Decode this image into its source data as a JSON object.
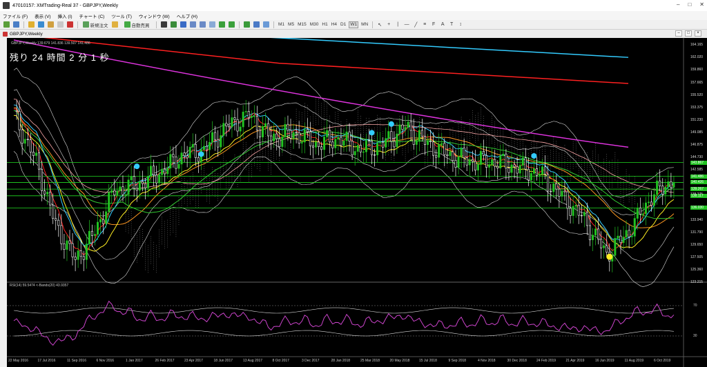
{
  "window": {
    "title": "47010157: XMTrading-Real 37 - GBPJPY,Weekly",
    "controls": [
      "–",
      "□",
      "✕"
    ]
  },
  "menu": [
    "ファイル (F)",
    "表示 (V)",
    "挿入 (I)",
    "チャート (C)",
    "ツール (T)",
    "ウィンドウ (W)",
    "ヘルプ (H)"
  ],
  "toolbar": {
    "new_order": "新規注文",
    "auto_trade": "自動売買",
    "timeframes": [
      "M1",
      "M5",
      "M15",
      "M30",
      "H1",
      "H4",
      "D1",
      "W1",
      "MN"
    ],
    "icons": [
      "new-chart-icon",
      "profiles-icon",
      "market-watch-icon",
      "data-window-icon",
      "navigator-icon",
      "terminal-icon",
      "strategy-tester-icon",
      "zoom-in-icon",
      "zoom-out-icon",
      "tile-icon",
      "scroll-icon",
      "shift-icon",
      "indicators-icon",
      "periods-icon",
      "templates-icon",
      "cursor-icon",
      "crosshair-icon",
      "vline-icon",
      "hline-icon",
      "trendline-icon",
      "channel-icon",
      "fibo-icon",
      "text-icon",
      "label-icon",
      "arrows-icon"
    ]
  },
  "chart_tab": {
    "label": "GBPJPY,Weekly"
  },
  "chart": {
    "header": "GBPJPY,Weekly  139.679 141.836 139.507 141.486",
    "countdown": "残り 24 時間 2 分 1 秒",
    "rsi_header": "RSI(14) 59.5474  <-Bands(20) 43.9357",
    "price_labels": [
      "164.165",
      "162.020",
      "159.860",
      "157.665",
      "155.520",
      "153.375",
      "151.230",
      "149.085",
      "146.875",
      "144.730",
      "142.585",
      "140.430",
      "138.275",
      "136.030",
      "133.940",
      "131.790",
      "129.650",
      "127.505",
      "125.360",
      "123.215"
    ],
    "highlight_labels": [
      "143.867",
      "141.486",
      "140.426",
      "139.267",
      "138.117",
      "136.030"
    ],
    "date_labels": [
      "22 May 2016",
      "17 Jul 2016",
      "11 Sep 2016",
      "6 Nov 2016",
      "1 Jan 2017",
      "26 Feb 2017",
      "23 Apr 2017",
      "18 Jun 2017",
      "13 Aug 2017",
      "8 Oct 2017",
      "3 Dec 2017",
      "28 Jan 2018",
      "25 Mar 2018",
      "20 May 2018",
      "15 Jul 2018",
      "9 Sep 2018",
      "4 Nov 2018",
      "30 Dec 2018",
      "24 Feb 2019",
      "21 Apr 2019",
      "16 Jun 2019",
      "11 Aug 2019",
      "6 Oct 2019"
    ],
    "rsi_scale": [
      "70",
      "30"
    ],
    "colors": {
      "background": "#000000",
      "bull": "#22c322",
      "bear": "#ffffff",
      "ma_cyan": "#33ccff",
      "ma_red": "#ff2020",
      "ma_magenta": "#dd33dd",
      "ma_orange": "#ff9922",
      "ma_yellow": "#ffee22",
      "ma_green": "#33cc33",
      "ma_lightgreen": "#88ff66",
      "level_green": "#22dd22",
      "rsi_line": "#cc44cc"
    }
  }
}
